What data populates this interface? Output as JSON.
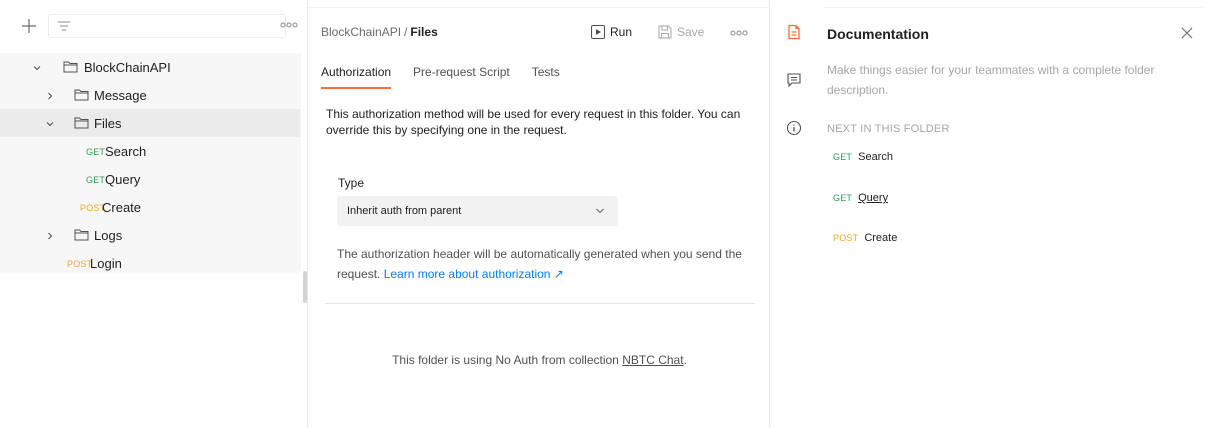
{
  "colors": {
    "accent": "#ff6c37",
    "get": "#2e9d5a",
    "post": "#f0a72b",
    "link": "#097bed"
  },
  "sidebar": {
    "collection": "BlockChainAPI",
    "folders": {
      "message": "Message",
      "files": "Files",
      "logs": "Logs"
    },
    "files_requests": [
      {
        "method": "GET",
        "name": "Search"
      },
      {
        "method": "GET",
        "name": "Query"
      },
      {
        "method": "POST",
        "name": "Create"
      }
    ],
    "login": {
      "method": "POST",
      "name": "Login"
    }
  },
  "header": {
    "breadcrumb_parent": "BlockChainAPI",
    "breadcrumb_sep": "/",
    "breadcrumb_current": "Files",
    "run_label": "Run",
    "save_label": "Save"
  },
  "tabs": [
    "Authorization",
    "Pre-request Script",
    "Tests"
  ],
  "auth": {
    "description": "This authorization method will be used for every request in this folder. You can override this by specifying one in the request.",
    "type_label": "Type",
    "type_value": "Inherit auth from parent",
    "info": "The authorization header will be automatically generated when you send the request.",
    "learn_more": "Learn more about authorization ↗",
    "noauth_prefix": "This folder is using No Auth from collection",
    "noauth_collection": "NBTC Chat",
    "noauth_suffix": "."
  },
  "documentation": {
    "title": "Documentation",
    "description": "Make things easier for your teammates with a complete folder description.",
    "next_heading": "NEXT IN THIS FOLDER",
    "requests": [
      {
        "method": "GET",
        "name": "Search"
      },
      {
        "method": "GET",
        "name": "Query"
      },
      {
        "method": "POST",
        "name": "Create"
      }
    ]
  }
}
